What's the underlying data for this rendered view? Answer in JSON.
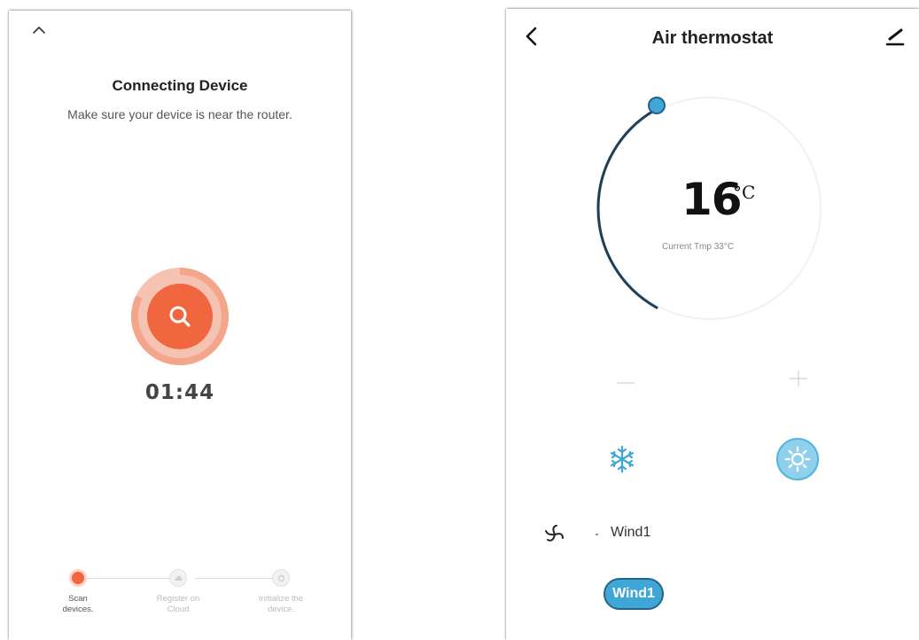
{
  "left_screen": {
    "title": "Connecting Device",
    "subtitle": "Make sure your device is near the router.",
    "countdown": "01:44",
    "scan_progress": 0.82,
    "colors": {
      "accent": "#f0673f",
      "accent_light": "#f6c2b1"
    },
    "icons": {
      "collapse": "chevron-up-icon",
      "scan": "search-icon"
    },
    "steps": [
      {
        "label_line1": "Scan",
        "label_line2": "devices.",
        "state": "active"
      },
      {
        "label_line1": "Register on",
        "label_line2": "Cloud",
        "state": "pending"
      },
      {
        "label_line1": "Initialize the",
        "label_line2": "device.",
        "state": "pending"
      }
    ]
  },
  "right_screen": {
    "title": "Air thermostat",
    "set_temp": "16",
    "unit": "°C",
    "current_temp_label": "Current Tmp 33°C",
    "wind_label": "Wind1",
    "wind_button_label": "Wind1",
    "colors": {
      "accent": "#3fa6d6",
      "dark_accent": "#23658a"
    },
    "icons": {
      "back": "chevron-left-icon",
      "edit": "pencil-icon",
      "cool": "snowflake-icon",
      "heat": "sun-icon",
      "fan": "fan-icon",
      "minus": "minus-icon",
      "plus": "plus-icon"
    }
  }
}
